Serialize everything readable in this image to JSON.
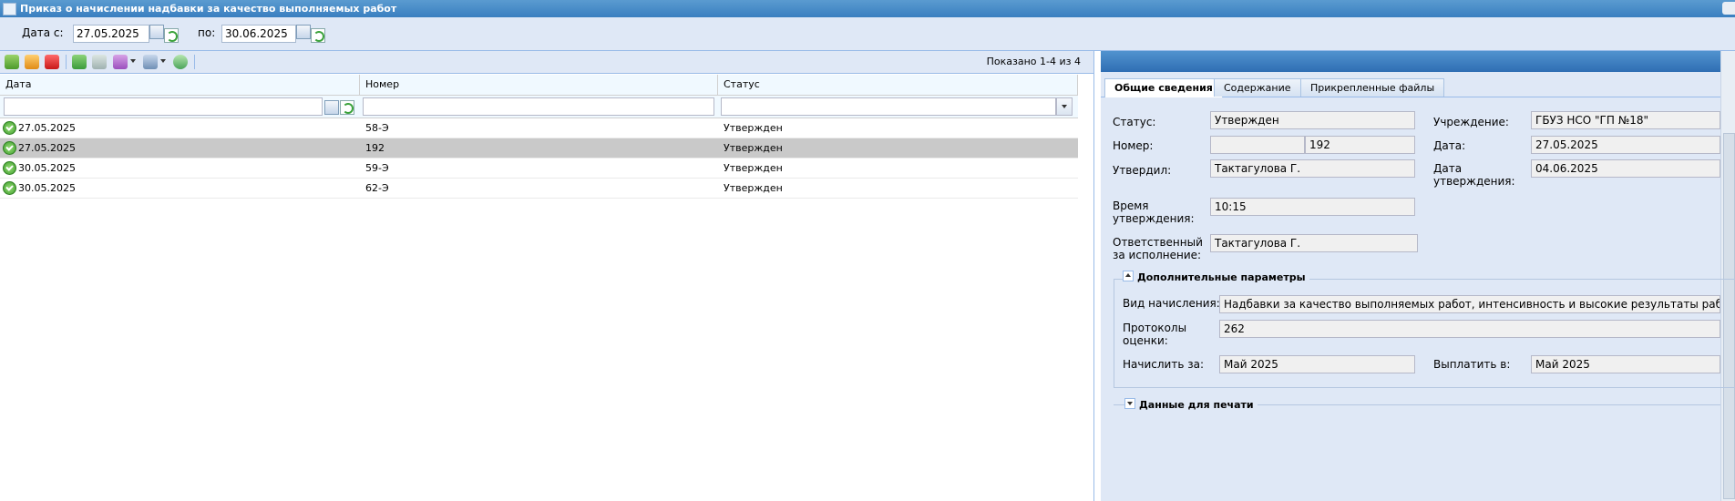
{
  "window": {
    "title": "Приказ о начислении надбавки за качество выполняемых работ"
  },
  "filter": {
    "date_from_label": "Дата с:",
    "date_from": "27.05.2025",
    "date_to_label": "по:",
    "date_to": "30.06.2025"
  },
  "toolbar": {
    "shown_text": "Показано 1-4 из 4",
    "buttons": [
      "add-icon",
      "edit-icon",
      "delete-icon",
      "approve-icon",
      "unapprove-icon",
      "actions-icon",
      "print-icon",
      "refresh-icon"
    ]
  },
  "grid": {
    "columns": [
      "Дата",
      "Номер",
      "Статус"
    ],
    "rows": [
      {
        "date": "27.05.2025",
        "number": "58-Э",
        "status": "Утвержден"
      },
      {
        "date": "27.05.2025",
        "number": "192",
        "status": "Утвержден",
        "selected": true
      },
      {
        "date": "30.05.2025",
        "number": "59-Э",
        "status": "Утвержден"
      },
      {
        "date": "30.05.2025",
        "number": "62-Э",
        "status": "Утвержден"
      }
    ]
  },
  "tabs": [
    "Общие сведения",
    "Содержание",
    "Прикрепленные файлы"
  ],
  "details": {
    "status_label": "Статус:",
    "status": "Утвержден",
    "institution_label": "Учреждение:",
    "institution": "ГБУЗ НСО \"ГП №18\"",
    "number_label": "Номер:",
    "number_prefix": "",
    "number": "192",
    "date_label": "Дата:",
    "date": "27.05.2025",
    "approved_by_label": "Утвердил:",
    "approved_by": "Тактагулова Г.",
    "approval_date_label": "Дата утверждения:",
    "approval_date": "04.06.2025",
    "approval_time_label": "Время утверждения:",
    "approval_time": "10:15",
    "responsible_label": "Ответственный за исполнение:",
    "responsible": "Тактагулова Г."
  },
  "extra": {
    "legend": "Дополнительные параметры",
    "accrual_type_label": "Вид начисления:",
    "accrual_type": "Надбавки за качество выполняемых работ, интенсивность и высокие результаты работы",
    "protocols_label": "Протоколы оценки:",
    "protocols": "262",
    "accrue_for_label": "Начислить за:",
    "accrue_for": "Май 2025",
    "pay_in_label": "Выплатить в:",
    "pay_in": "Май 2025"
  },
  "print_section": {
    "legend": "Данные для печати"
  },
  "colors": {
    "title_bar": "#3a7fc0",
    "panel_bg": "#dfe8f6",
    "selected_row": "#c9c9c9",
    "accent": "#2f6eb3"
  }
}
